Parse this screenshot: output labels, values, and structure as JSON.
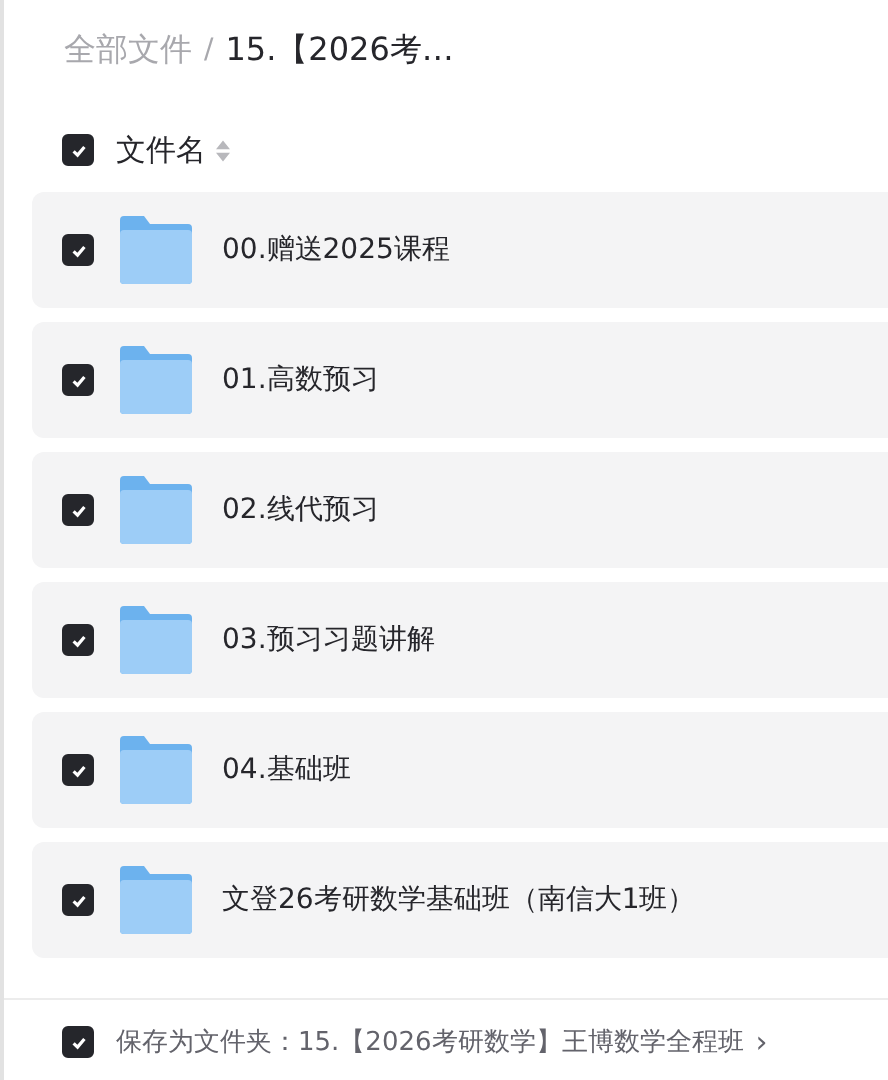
{
  "breadcrumb": {
    "root": "全部文件",
    "separator": "/",
    "current": "15.【2026考…"
  },
  "header": {
    "checked": true,
    "label": "文件名"
  },
  "files": [
    {
      "name": "00.赠送2025课程",
      "checked": true
    },
    {
      "name": "01.高数预习",
      "checked": true
    },
    {
      "name": "02.线代预习",
      "checked": true
    },
    {
      "name": "03.预习习题讲解",
      "checked": true
    },
    {
      "name": "04.基础班",
      "checked": true
    },
    {
      "name": "文登26考研数学基础班（南信大1班）",
      "checked": true
    }
  ],
  "footer": {
    "checked": true,
    "text": "保存为文件夹：15.【2026考研数学】王博数学全程班",
    "chevron": "›"
  }
}
